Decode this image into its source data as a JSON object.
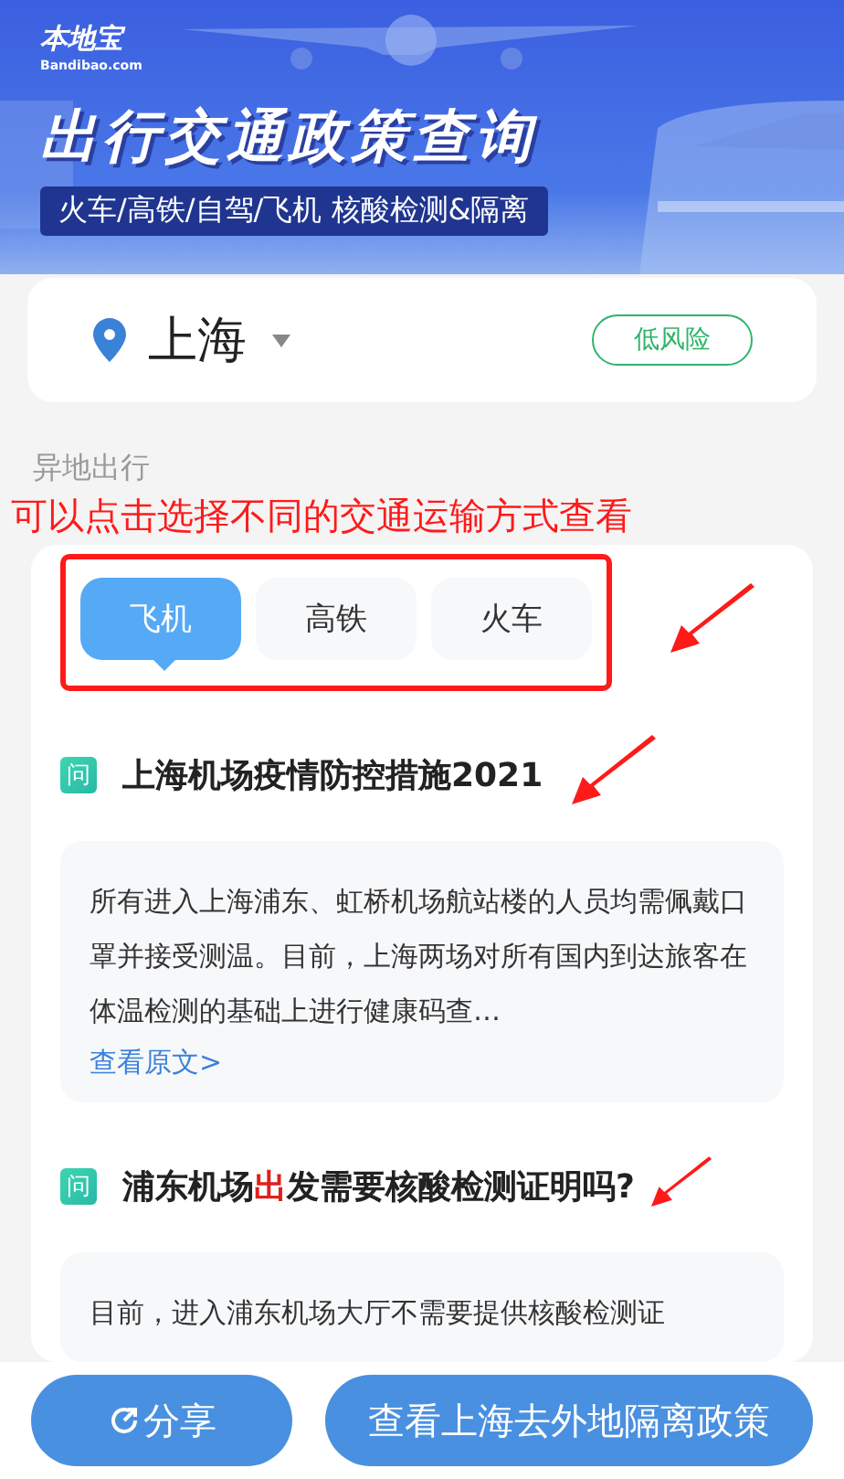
{
  "banner": {
    "logo": "本地宝",
    "logo_domain": "Bandibao.com",
    "title": "出行交通政策查询",
    "subtitle": "火车/高铁/自驾/飞机 核酸检测&隔离"
  },
  "city": {
    "name": "上海",
    "risk": "低风险"
  },
  "section_label": "异地出行",
  "annotation": "可以点击选择不同的交通运输方式查看",
  "tabs": [
    {
      "label": "飞机",
      "selected": true
    },
    {
      "label": "高铁",
      "selected": false
    },
    {
      "label": "火车",
      "selected": false
    }
  ],
  "questions": [
    {
      "badge": "问",
      "title_parts": [
        {
          "text": "上海机场疫情防控措施2021",
          "highlight": false
        }
      ],
      "answer": "所有进入上海浦东、虹桥机场航站楼的人员均需佩戴口罩并接受测温。目前，上海两场对所有国内到达旅客在体温检测的基础上进行健康码查…",
      "link": "查看原文>"
    },
    {
      "badge": "问",
      "title_parts": [
        {
          "text": "浦东机场",
          "highlight": false
        },
        {
          "text": "出",
          "highlight": true
        },
        {
          "text": "发需要核酸检测证明吗?",
          "highlight": false
        }
      ],
      "answer": "目前，进入浦东机场大厅不需要提供核酸检测证"
    }
  ],
  "buttons": {
    "share": "分享",
    "policy": "查看上海去外地隔离政策"
  }
}
